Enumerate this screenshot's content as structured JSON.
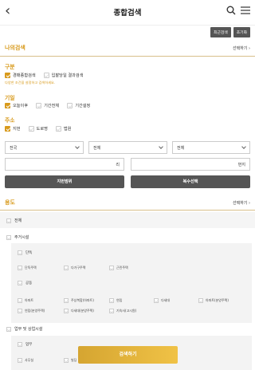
{
  "header": {
    "title": "종합검색"
  },
  "top_buttons": {
    "recent": "최근검색",
    "reset": "초기화"
  },
  "my_search": {
    "title": "나의검색",
    "select": "선택하기"
  },
  "category": {
    "title": "구분",
    "options": [
      {
        "label": "경매종합검색",
        "checked": true
      },
      {
        "label": "입찰당일 결과검색",
        "checked": false
      }
    ],
    "note": "다양한 조건을 설정하고 검색하세요."
  },
  "date": {
    "title": "기일",
    "options": [
      {
        "label": "오늘이후",
        "checked": true
      },
      {
        "label": "기간전체",
        "checked": false
      },
      {
        "label": "기간설정",
        "checked": false
      }
    ]
  },
  "address": {
    "title": "주소",
    "options": [
      {
        "label": "지번",
        "checked": true
      },
      {
        "label": "도로명",
        "checked": false
      },
      {
        "label": "법원",
        "checked": false
      }
    ],
    "selects": [
      "전국",
      "전체",
      "전체"
    ],
    "ri_suffix": "리",
    "jibun_suffix": "번지",
    "map_button": "지번범위",
    "multi_button": "복수선택"
  },
  "usage": {
    "title": "용도",
    "select": "선택하기",
    "all": "전체",
    "residential": {
      "label": "주거시설",
      "group1": "단독",
      "group1_items": [
        "단독주택",
        "다가구주택",
        "근린주택"
      ],
      "group2": "공동",
      "group2_items": [
        "아파트",
        "주상복합(아파트)",
        "연립",
        "다세대",
        "아파트(분양주택)"
      ],
      "group2_items_row2": [
        "연립(분양주택)",
        "다세대(분양주택)",
        "기숙사(고시원)"
      ]
    },
    "commercial": {
      "label": "업무 및 상업시설",
      "group1": "업무",
      "group1_items": [
        "사무실",
        "빌딩"
      ]
    }
  },
  "search_button": "검색하기"
}
